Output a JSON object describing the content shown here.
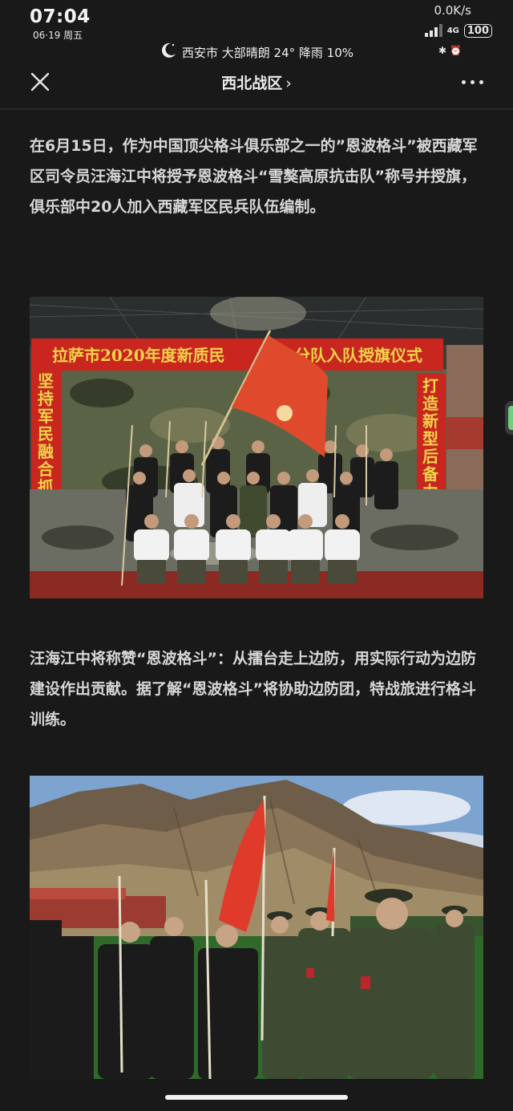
{
  "status_bar": {
    "time": "07:04",
    "date": "06·19 周五",
    "net_speed": "0.0K/s",
    "network_type": "4G",
    "battery": "100",
    "weather": "西安市 大部晴朗 24° 降雨 10%",
    "icons": [
      "moon-icon",
      "signal-icon",
      "bluetooth-icon",
      "alarm-icon"
    ]
  },
  "nav": {
    "title": "西北战区",
    "chevron": "›",
    "close_icon": "close-icon",
    "more_icon": "more-icon"
  },
  "article": {
    "paragraph1": "在6月15日，作为中国顶尖格斗俱乐部之一的”恩波格斗”被西藏军区司令员汪海江中将授予恩波格斗“雪獒高原抗击队”称号并授旗，俱乐部中20人加入西藏军区民兵队伍编制。",
    "photo1": {
      "banner_top": "拉萨市2020年度新质民",
      "banner_top_right": "分队入队授旗仪式",
      "banner_left": [
        "坚",
        "持",
        "军",
        "民",
        "融",
        "合",
        "抓"
      ],
      "banner_right": [
        "打",
        "造",
        "新",
        "型",
        "后",
        "备",
        "力"
      ]
    },
    "paragraph2": "汪海江中将称赞“恩波格斗”：从擂台走上边防，用实际行动为边防建设作出贡献。据了解“恩波格斗”将协助边防团，特战旅进行格斗训练。"
  },
  "colors": {
    "background": "#191919",
    "text": "#d7d7d7",
    "banner_red": "#c8261e",
    "banner_yellow": "#f2d44a"
  }
}
